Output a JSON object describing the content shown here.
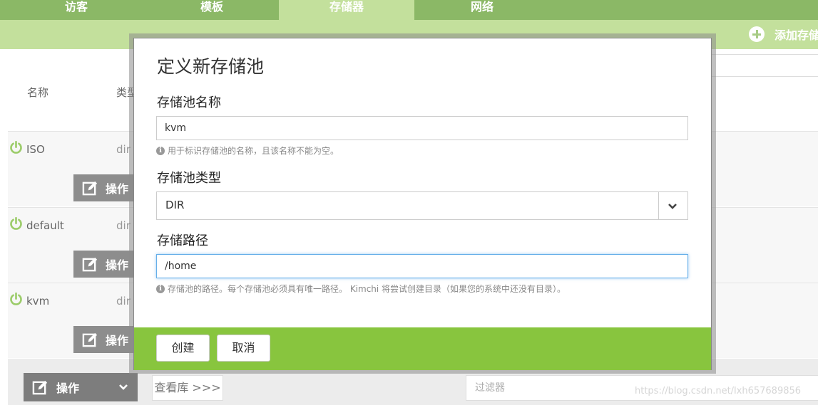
{
  "nav": {
    "tabs": [
      {
        "label": "访客"
      },
      {
        "label": "模板"
      },
      {
        "label": "存储器"
      },
      {
        "label": "网络"
      }
    ],
    "active_tab": "存储器"
  },
  "actionbar": {
    "add_label": "添加存储"
  },
  "table": {
    "headers": {
      "name": "名称",
      "type": "类型"
    },
    "rows": [
      {
        "name": "ISO",
        "type": "dir",
        "action_label": "操作"
      },
      {
        "name": "default",
        "type": "dir",
        "action_label": "操作"
      },
      {
        "name": "kvm",
        "type": "dir",
        "action_label": "操作"
      }
    ]
  },
  "bottombar": {
    "action_label": "操作",
    "view_repo_label": "查看库 >>>",
    "filter_placeholder": "过滤器"
  },
  "watermark": "https://blog.csdn.net/lxh657689856",
  "modal": {
    "title": "定义新存储池",
    "name_field": {
      "label": "存储池名称",
      "value": "kvm",
      "help": "用于标识存储池的名称，且该名称不能为空。"
    },
    "type_field": {
      "label": "存储池类型",
      "value": "DIR"
    },
    "path_field": {
      "label": "存储路径",
      "value": "/home",
      "help": "存储池的路径。每个存储池必须具有唯一路径。 Kimchi 将尝试创建目录（如果您的系统中还没有目录）。"
    },
    "create_label": "创建",
    "cancel_label": "取消"
  },
  "colors": {
    "nav_bg": "#8bb866",
    "active_tab_bg": "#c3e09c",
    "modal_footer_bg": "#88c53e",
    "power_icon": "#9ccc6a",
    "action_button_bg": "#8d8d8d"
  },
  "icons": {
    "add": "plus-circle-icon",
    "power": "power-icon",
    "edit": "edit-icon",
    "info": "info-icon",
    "chevron": "chevron-down-icon"
  }
}
